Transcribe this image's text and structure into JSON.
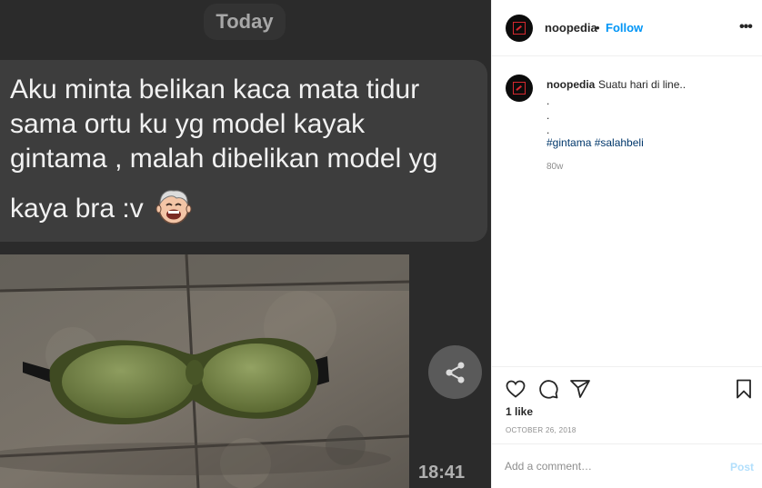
{
  "media": {
    "day_label": "Today",
    "message_lines": [
      "Aku minta belikan kaca mata tidur",
      "sama ortu ku yg model kayak",
      "gintama , malah dibelikan model yg",
      "kaya bra :v"
    ],
    "sticker_icon": "laughing-face-sticker",
    "photo_icon": "green-sleep-mask-photo",
    "share_icon": "share-icon",
    "timestamp": "18:41"
  },
  "header": {
    "username": "noopedia",
    "separator": "•",
    "follow_label": "Follow",
    "more_icon": "more-options-icon",
    "avatar_icon": "noopedia-logo-avatar"
  },
  "caption": {
    "username": "noopedia",
    "text": "Suatu hari di line..",
    "dots": [
      ".",
      ".",
      "."
    ],
    "hashtags": "#gintama #salahbeli",
    "age": "80w"
  },
  "actions": {
    "icons": [
      "heart-icon",
      "comment-icon",
      "share-direct-icon",
      "bookmark-icon"
    ],
    "likes": "1 like",
    "date": "OCTOBER 26, 2018"
  },
  "comment": {
    "placeholder": "Add a comment…",
    "post_label": "Post"
  },
  "colors": {
    "link_blue": "#0095f6",
    "hashtag_blue": "#00376b",
    "post_disabled": "#b2dffc",
    "logo_red": "#d6282f"
  }
}
